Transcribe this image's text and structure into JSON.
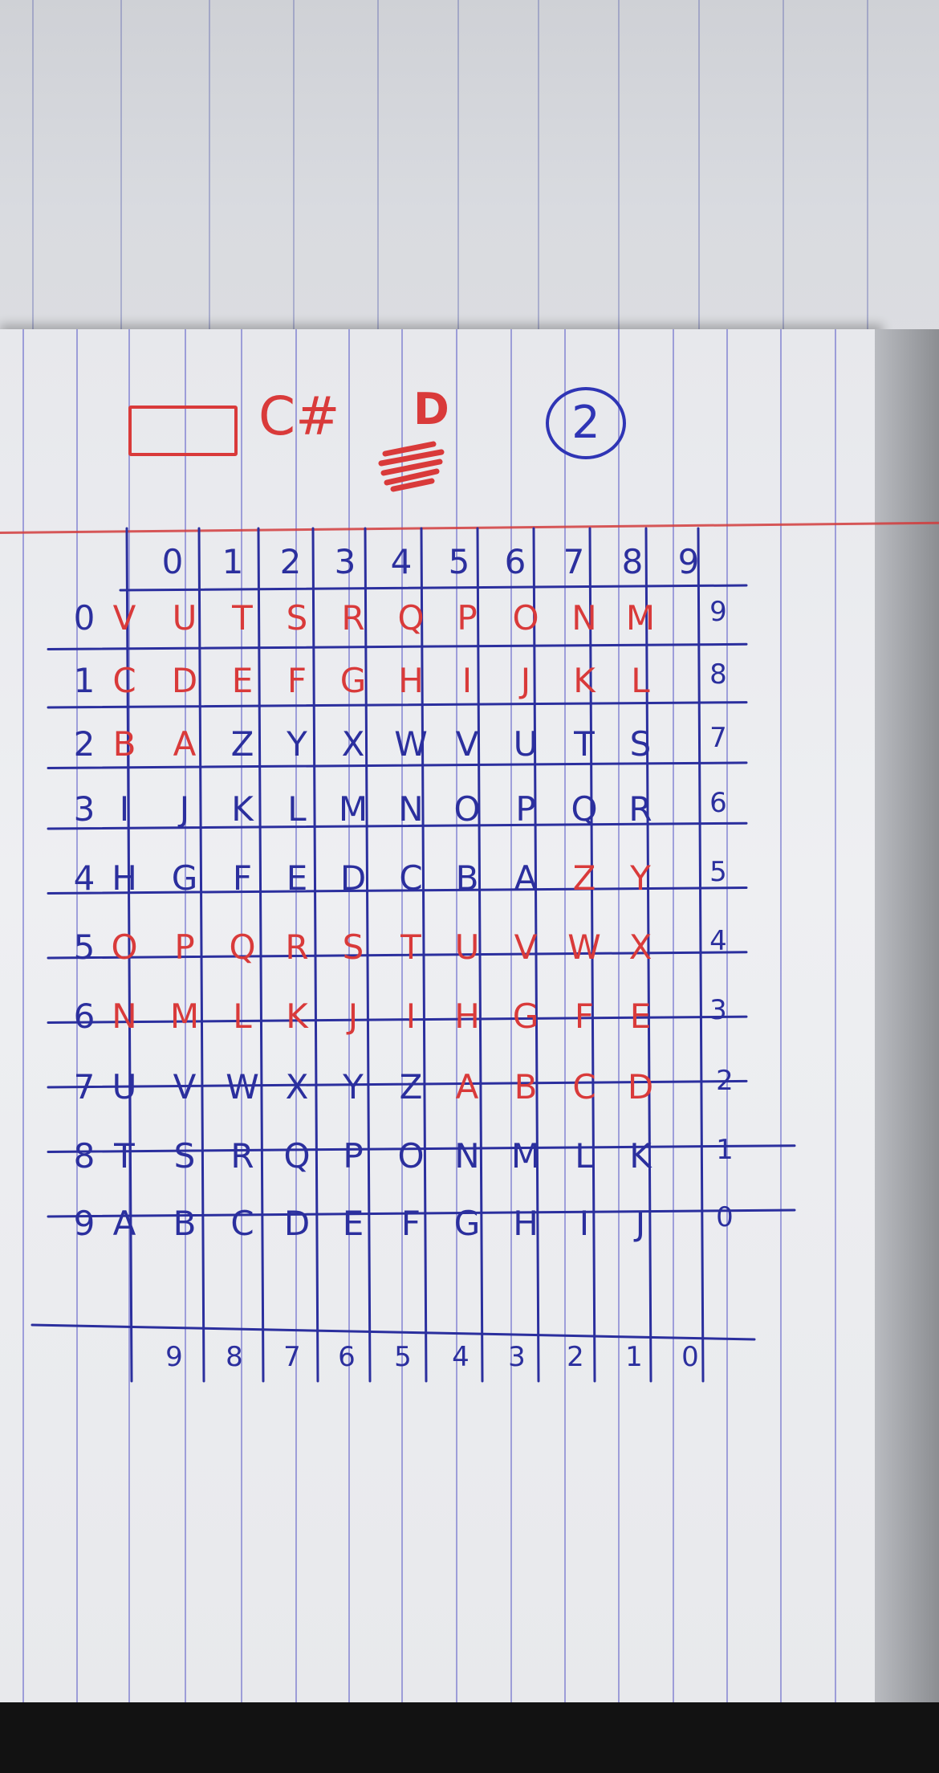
{
  "heading": {
    "language": "C#",
    "mark": "D",
    "circled_number": "2"
  },
  "col_headers_top": [
    "0",
    "1",
    "2",
    "3",
    "4",
    "5",
    "6",
    "7",
    "8",
    "9"
  ],
  "col_headers_bottom": [
    "9",
    "8",
    "7",
    "6",
    "5",
    "4",
    "3",
    "2",
    "1",
    "0"
  ],
  "row_headers_left": [
    "0",
    "1",
    "2",
    "3",
    "4",
    "5",
    "6",
    "7",
    "8",
    "9"
  ],
  "row_headers_right": [
    "9",
    "8",
    "7",
    "6",
    "5",
    "4",
    "3",
    "2",
    "1",
    "0"
  ],
  "rows": [
    [
      "V",
      "U",
      "T",
      "S",
      "R",
      "Q",
      "P",
      "O",
      "N",
      "M"
    ],
    [
      "C",
      "D",
      "E",
      "F",
      "G",
      "H",
      "I",
      "J",
      "K",
      "L"
    ],
    [
      "B",
      "A",
      "Z",
      "Y",
      "X",
      "W",
      "V",
      "U",
      "T",
      "S"
    ],
    [
      "I",
      "J",
      "K",
      "L",
      "M",
      "N",
      "O",
      "P",
      "Q",
      "R"
    ],
    [
      "H",
      "G",
      "F",
      "E",
      "D",
      "C",
      "B",
      "A",
      "Z",
      "Y"
    ],
    [
      "O",
      "P",
      "Q",
      "R",
      "S",
      "T",
      "U",
      "V",
      "W",
      "X"
    ],
    [
      "N",
      "M",
      "L",
      "K",
      "J",
      "I",
      "H",
      "G",
      "F",
      "E"
    ],
    [
      "U",
      "V",
      "W",
      "X",
      "Y",
      "Z",
      "A",
      "B",
      "C",
      "D"
    ],
    [
      "T",
      "S",
      "R",
      "Q",
      "P",
      "O",
      "N",
      "M",
      "L",
      "K"
    ],
    [
      "A",
      "B",
      "C",
      "D",
      "E",
      "F",
      "G",
      "H",
      "I",
      "J"
    ]
  ],
  "ink_colors": {
    "red": "#d93a3a",
    "blue": "#2b2f9e"
  },
  "cell_colors": [
    [
      "red",
      "red",
      "red",
      "red",
      "red",
      "red",
      "red",
      "red",
      "red",
      "red"
    ],
    [
      "red",
      "red",
      "red",
      "red",
      "red",
      "red",
      "red",
      "red",
      "red",
      "red"
    ],
    [
      "red",
      "red",
      "blue",
      "blue",
      "blue",
      "blue",
      "blue",
      "blue",
      "blue",
      "blue"
    ],
    [
      "blue",
      "blue",
      "blue",
      "blue",
      "blue",
      "blue",
      "blue",
      "blue",
      "blue",
      "blue"
    ],
    [
      "blue",
      "blue",
      "blue",
      "blue",
      "blue",
      "blue",
      "blue",
      "blue",
      "red",
      "red"
    ],
    [
      "red",
      "red",
      "red",
      "red",
      "red",
      "red",
      "red",
      "red",
      "red",
      "red"
    ],
    [
      "red",
      "red",
      "red",
      "red",
      "red",
      "red",
      "red",
      "red",
      "red",
      "red"
    ],
    [
      "blue",
      "blue",
      "blue",
      "blue",
      "blue",
      "blue",
      "red",
      "red",
      "red",
      "red"
    ],
    [
      "blue",
      "blue",
      "blue",
      "blue",
      "blue",
      "blue",
      "blue",
      "blue",
      "blue",
      "blue"
    ],
    [
      "blue",
      "blue",
      "blue",
      "blue",
      "blue",
      "blue",
      "blue",
      "blue",
      "blue",
      "blue"
    ]
  ]
}
